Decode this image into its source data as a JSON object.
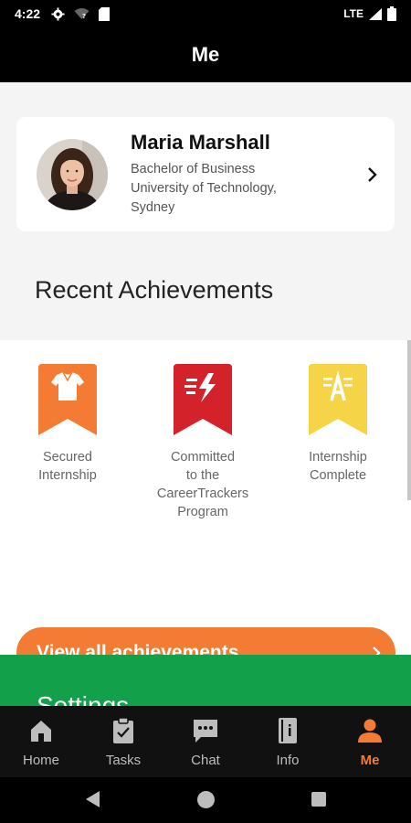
{
  "status_bar": {
    "time": "4:22",
    "network": "LTE",
    "icons": [
      "gear-icon",
      "wifi-off-icon",
      "sd-card-icon",
      "signal-icon",
      "battery-icon"
    ]
  },
  "app_bar": {
    "title": "Me"
  },
  "profile": {
    "name": "Maria Marshall",
    "degree": "Bachelor of Business",
    "university_line1": "University of Technology,",
    "university_line2": "Sydney"
  },
  "achievements": {
    "title": "Recent Achievements",
    "items": [
      {
        "label_line1": "Secured",
        "label_line2": "Internship",
        "label_line3": "",
        "label_line4": "",
        "color": "#f47b33",
        "icon": "shirt-icon"
      },
      {
        "label_line1": "Committed",
        "label_line2": "to the",
        "label_line3": "CareerTrackers",
        "label_line4": "Program",
        "color": "#d4222a",
        "icon": "lightning-icon"
      },
      {
        "label_line1": "Internship",
        "label_line2": "Complete",
        "label_line3": "",
        "label_line4": "",
        "color": "#f5d547",
        "icon": "letter-a-icon"
      }
    ],
    "view_all_label": "View all achievements"
  },
  "settings": {
    "title": "Settings"
  },
  "bottom_nav": {
    "items": [
      {
        "label": "Home",
        "icon": "home-icon"
      },
      {
        "label": "Tasks",
        "icon": "clipboard-icon"
      },
      {
        "label": "Chat",
        "icon": "chat-icon"
      },
      {
        "label": "Info",
        "icon": "info-book-icon"
      },
      {
        "label": "Me",
        "icon": "person-icon",
        "active": true
      }
    ]
  },
  "colors": {
    "accent": "#f47b33",
    "settings_green": "#13a04a",
    "badge_red": "#d4222a",
    "badge_yellow": "#f5d547"
  }
}
